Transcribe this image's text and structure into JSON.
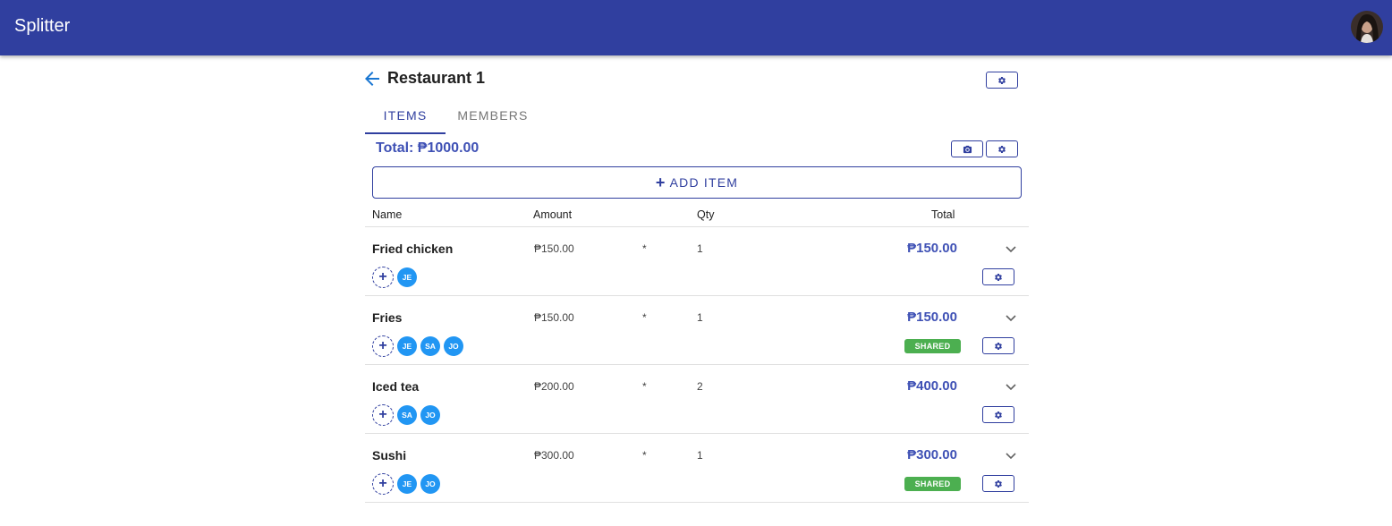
{
  "app": {
    "title": "Splitter"
  },
  "page": {
    "title": "Restaurant 1"
  },
  "tabs": [
    {
      "label": "Items",
      "active": true
    },
    {
      "label": "Members",
      "active": false
    }
  ],
  "summary": {
    "total": "Total: ₱1000.00"
  },
  "actions": {
    "add_item": "ADD ITEM"
  },
  "columns": {
    "name": "Name",
    "amount": "Amount",
    "qty": "Qty",
    "total": "Total"
  },
  "items": [
    {
      "name": "Fried chicken",
      "amount": "₱150.00",
      "op": "*",
      "qty": "1",
      "total": "₱150.00",
      "members": [
        "JE"
      ],
      "shared": false
    },
    {
      "name": "Fries",
      "amount": "₱150.00",
      "op": "*",
      "qty": "1",
      "total": "₱150.00",
      "members": [
        "JE",
        "SA",
        "JO"
      ],
      "shared": true,
      "badge": "SHARED"
    },
    {
      "name": "Iced tea",
      "amount": "₱200.00",
      "op": "*",
      "qty": "2",
      "total": "₱400.00",
      "members": [
        "SA",
        "JO"
      ],
      "shared": false
    },
    {
      "name": "Sushi",
      "amount": "₱300.00",
      "op": "*",
      "qty": "1",
      "total": "₱300.00",
      "members": [
        "JE",
        "JO"
      ],
      "shared": true,
      "badge": "SHARED"
    }
  ],
  "icons": {
    "back": "arrow-left-icon",
    "settings": "gear-icon",
    "camera": "camera-icon",
    "expand": "chevron-down-icon",
    "add_member": "plus-icon"
  },
  "colors": {
    "primary": "#303f9f",
    "accent_text": "#3f51b5",
    "chip": "#2196f3",
    "shared_badge": "#4caf50"
  }
}
